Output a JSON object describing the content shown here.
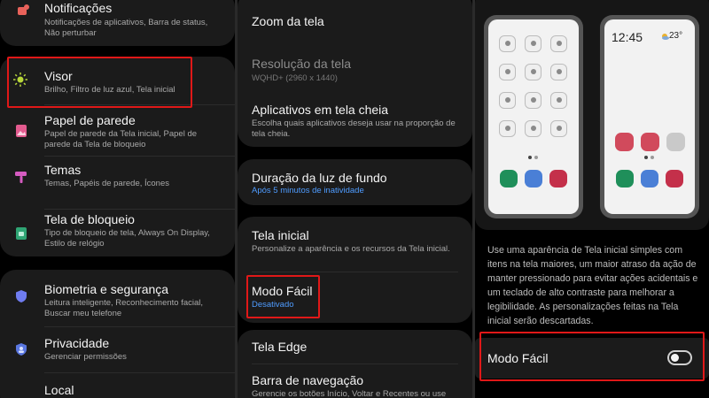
{
  "panel1": {
    "notifications": {
      "title": "Notificações",
      "subtitle": "Notificações de aplicativos, Barra de status, Não perturbar"
    },
    "display": {
      "title": "Visor",
      "subtitle": "Brilho, Filtro de luz azul, Tela inicial"
    },
    "wallpaper": {
      "title": "Papel de parede",
      "subtitle": "Papel de parede da Tela inicial, Papel de parede da Tela de bloqueio"
    },
    "themes": {
      "title": "Temas",
      "subtitle": "Temas, Papéis de parede, Ícones"
    },
    "lockscreen": {
      "title": "Tela de bloqueio",
      "subtitle": "Tipo de bloqueio de tela, Always On Display, Estilo de relógio"
    },
    "biometrics": {
      "title": "Biometria e segurança",
      "subtitle": "Leitura inteligente, Reconhecimento facial, Buscar meu telefone"
    },
    "privacy": {
      "title": "Privacidade",
      "subtitle": "Gerenciar permissões"
    },
    "location": {
      "title": "Local"
    }
  },
  "panel2": {
    "zoom": {
      "title": "Zoom da tela"
    },
    "resolution": {
      "title": "Resolução da tela",
      "subtitle": "WQHD+ (2960 x 1440)"
    },
    "fullscreen": {
      "title": "Aplicativos em tela cheia",
      "subtitle": "Escolha quais aplicativos deseja usar na proporção de tela cheia."
    },
    "timeout": {
      "title": "Duração da luz de fundo",
      "subtitle": "Após 5 minutos de inatividade"
    },
    "homescreen": {
      "title": "Tela inicial",
      "subtitle": "Personalize a aparência e os recursos da Tela inicial."
    },
    "easymode": {
      "title": "Modo Fácil",
      "subtitle": "Desativado"
    },
    "edge": {
      "title": "Tela Edge"
    },
    "navbar": {
      "title": "Barra de navegação",
      "subtitle": "Gerencie os botões Início, Voltar e Recentes ou use"
    }
  },
  "panel3": {
    "clock": "12:45",
    "temperature": "23°",
    "description": "Use uma aparência de Tela inicial simples com itens na tela maiores, um maior atraso da ação de manter pressionado para evitar ações acidentais e um teclado de alto contraste para melhorar a legibilidade. As personalizações feitas na Tela inicial serão descartadas.",
    "easymode_label": "Modo Fácil",
    "easymode_enabled": false
  },
  "colors": {
    "highlight": "#e01818",
    "link": "#4f9cff",
    "dock_green": "#1f8f5a",
    "dock_blue": "#4a7fd6",
    "dock_red": "#c4304a",
    "app_red": "#d14a5c"
  }
}
